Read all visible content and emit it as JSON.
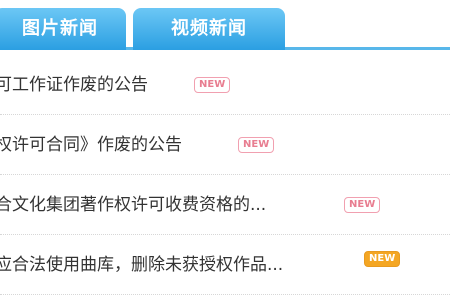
{
  "tabs": [
    {
      "label": "图片新闻"
    },
    {
      "label": "视频新闻"
    }
  ],
  "news": [
    {
      "title": "可工作证作废的公告",
      "badge": "NEW",
      "accent": "#e87d90"
    },
    {
      "title": "权许可合同》作废的公告",
      "badge": "NEW",
      "accent": "#e87d90"
    },
    {
      "title": "合文化集团著作权许可收费资格的...",
      "badge": "NEW",
      "accent": "#e87d90"
    },
    {
      "title": "应合法使用曲库，删除未获授权作品...",
      "badge": "NEW",
      "accent": "#f4a623"
    }
  ],
  "colors": {
    "tab_gradient_top": "#6cc7f5",
    "tab_gradient_bottom": "#2b9fe2",
    "divider": "#58b7ea"
  }
}
